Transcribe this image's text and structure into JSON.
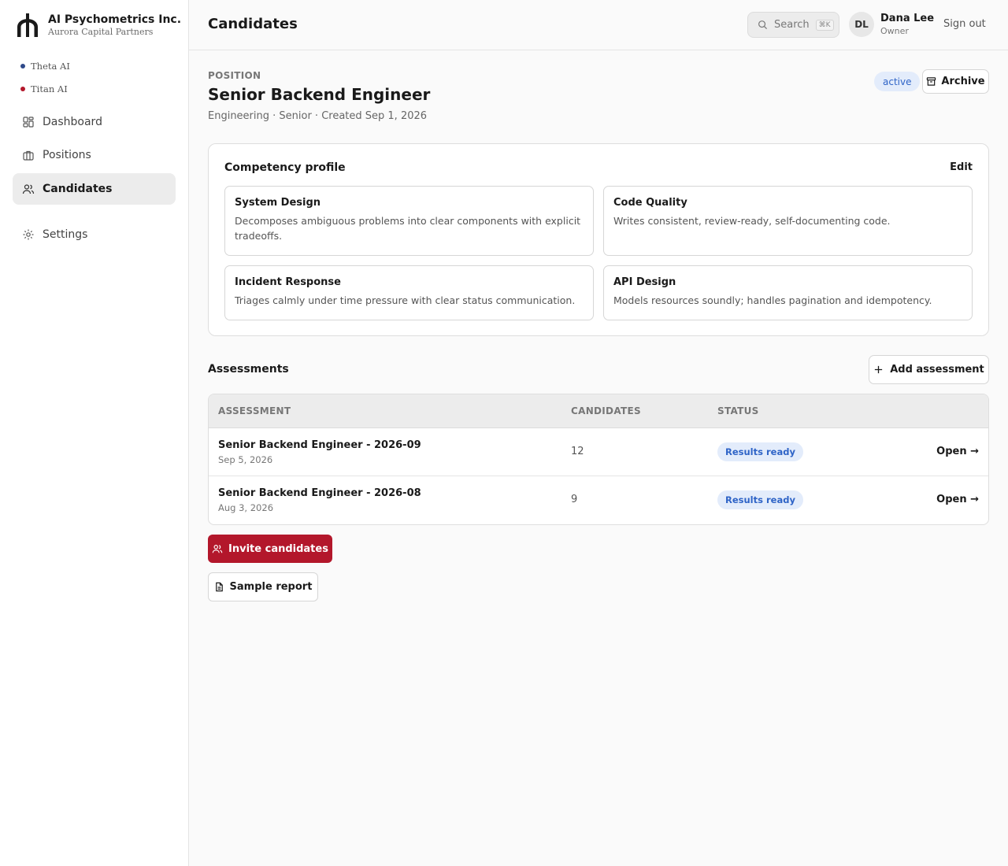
{
  "brand": {
    "name": "AI Psychometrics Inc.",
    "subtitle": "Aurora Capital Partners"
  },
  "workspaces": [
    {
      "label": "Theta AI",
      "color": "#2f4a8a"
    },
    {
      "label": "Titan AI",
      "color": "#b3172b"
    }
  ],
  "nav": {
    "dashboard": "Dashboard",
    "positions": "Positions",
    "candidates": "Candidates",
    "settings": "Settings"
  },
  "header": {
    "title": "Candidates",
    "search_placeholder": "Search",
    "search_shortcut": "⌘K",
    "user_initials": "DL",
    "user_name": "Dana Lee",
    "user_role": "Owner",
    "sign_out": "Sign out"
  },
  "position": {
    "label": "POSITION",
    "title": "Senior Backend Engineer",
    "meta": "Engineering · Senior · Created Sep 1, 2026",
    "status": "active",
    "archive_label": "Archive"
  },
  "competency": {
    "title": "Competency profile",
    "edit_label": "Edit",
    "items": [
      {
        "name": "System Design",
        "desc": "Decomposes ambiguous problems into clear components with explicit tradeoffs."
      },
      {
        "name": "Code Quality",
        "desc": "Writes consistent, review-ready, self-documenting code."
      },
      {
        "name": "Incident Response",
        "desc": "Triages calmly under time pressure with clear status communication."
      },
      {
        "name": "API Design",
        "desc": "Models resources soundly; handles pagination and idempotency."
      }
    ]
  },
  "assessments": {
    "title": "Assessments",
    "add_label": "Add assessment",
    "columns": {
      "assessment": "ASSESSMENT",
      "candidates": "CANDIDATES",
      "status": "STATUS"
    },
    "rows": [
      {
        "name": "Senior Backend Engineer - 2026-09",
        "date": "Sep 5, 2026",
        "candidates": "12",
        "status": "Results ready",
        "action": "Open →"
      },
      {
        "name": "Senior Backend Engineer - 2026-08",
        "date": "Aug 3, 2026",
        "candidates": "9",
        "status": "Results ready",
        "action": "Open →"
      }
    ]
  },
  "actions": {
    "invite_label": "Invite candidates",
    "sample_label": "Sample report"
  }
}
